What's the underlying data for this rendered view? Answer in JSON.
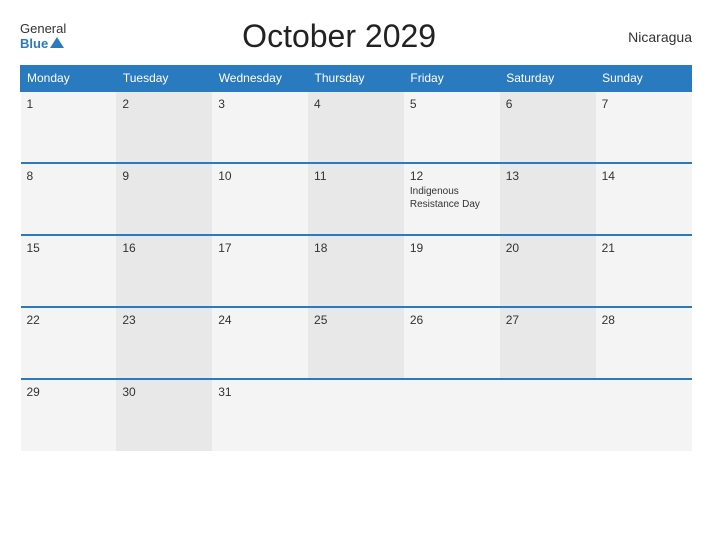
{
  "header": {
    "logo_general": "General",
    "logo_blue": "Blue",
    "title": "October 2029",
    "country": "Nicaragua"
  },
  "weekdays": [
    "Monday",
    "Tuesday",
    "Wednesday",
    "Thursday",
    "Friday",
    "Saturday",
    "Sunday"
  ],
  "weeks": [
    [
      {
        "day": "1",
        "holiday": ""
      },
      {
        "day": "2",
        "holiday": ""
      },
      {
        "day": "3",
        "holiday": ""
      },
      {
        "day": "4",
        "holiday": ""
      },
      {
        "day": "5",
        "holiday": ""
      },
      {
        "day": "6",
        "holiday": ""
      },
      {
        "day": "7",
        "holiday": ""
      }
    ],
    [
      {
        "day": "8",
        "holiday": ""
      },
      {
        "day": "9",
        "holiday": ""
      },
      {
        "day": "10",
        "holiday": ""
      },
      {
        "day": "11",
        "holiday": ""
      },
      {
        "day": "12",
        "holiday": "Indigenous Resistance Day"
      },
      {
        "day": "13",
        "holiday": ""
      },
      {
        "day": "14",
        "holiday": ""
      }
    ],
    [
      {
        "day": "15",
        "holiday": ""
      },
      {
        "day": "16",
        "holiday": ""
      },
      {
        "day": "17",
        "holiday": ""
      },
      {
        "day": "18",
        "holiday": ""
      },
      {
        "day": "19",
        "holiday": ""
      },
      {
        "day": "20",
        "holiday": ""
      },
      {
        "day": "21",
        "holiday": ""
      }
    ],
    [
      {
        "day": "22",
        "holiday": ""
      },
      {
        "day": "23",
        "holiday": ""
      },
      {
        "day": "24",
        "holiday": ""
      },
      {
        "day": "25",
        "holiday": ""
      },
      {
        "day": "26",
        "holiday": ""
      },
      {
        "day": "27",
        "holiday": ""
      },
      {
        "day": "28",
        "holiday": ""
      }
    ],
    [
      {
        "day": "29",
        "holiday": ""
      },
      {
        "day": "30",
        "holiday": ""
      },
      {
        "day": "31",
        "holiday": ""
      },
      {
        "day": "",
        "holiday": ""
      },
      {
        "day": "",
        "holiday": ""
      },
      {
        "day": "",
        "holiday": ""
      },
      {
        "day": "",
        "holiday": ""
      }
    ]
  ]
}
